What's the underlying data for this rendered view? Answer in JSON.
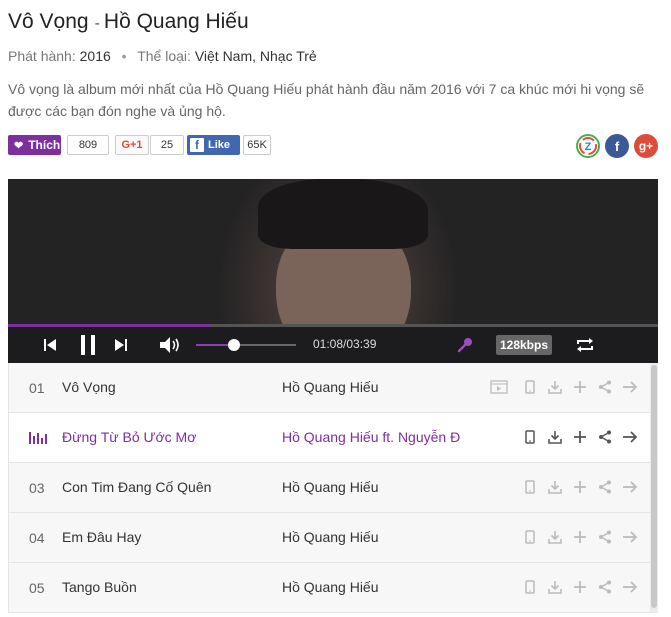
{
  "album": {
    "title": "Vô Vọng",
    "separator": "-",
    "artist": "Hồ Quang Hiếu",
    "release_label": "Phát hành:",
    "release_year": "2016",
    "genre_label": "Thể loại:",
    "genres": "Việt Nam, Nhạc Trẻ",
    "description": "Vô vọng là album mới nhất của Hồ Quang Hiếu phát hành đầu năm 2016 với 7 ca khúc mới hi vọng sẽ được các bạn đón nghe và ủng hộ."
  },
  "social": {
    "like_label": "Thích",
    "like_count": "809",
    "gplus_label": "G+1",
    "gplus_count": "25",
    "fb_label": "Like",
    "fb_count": "65K",
    "share_icons": [
      "zing-share-icon",
      "facebook-share-icon",
      "google-plus-share-icon"
    ]
  },
  "player": {
    "current_time": "01:08",
    "duration": "03:39",
    "time_display": "01:08/03:39",
    "progress_fraction": 0.31,
    "volume_fraction": 0.38,
    "bitrate": "128kbps",
    "accent_color": "#7d2f9e"
  },
  "tracks": [
    {
      "num": "01",
      "title": "Vô Vọng",
      "artist": "Hồ Quang Hiếu",
      "active": false,
      "has_mv": true
    },
    {
      "num": "",
      "title": "Đừng Từ Bỏ Ước Mơ",
      "artist": "Hồ Quang Hiếu  ft. Nguyễn Đ",
      "active": true,
      "has_mv": false
    },
    {
      "num": "03",
      "title": "Con Tim Đang Cố Quên",
      "artist": "Hồ Quang Hiếu",
      "active": false,
      "has_mv": false
    },
    {
      "num": "04",
      "title": "Em Đâu Hay",
      "artist": "Hồ Quang Hiếu",
      "active": false,
      "has_mv": false
    },
    {
      "num": "05",
      "title": "Tango Buồn",
      "artist": "Hồ Quang Hiếu",
      "active": false,
      "has_mv": false
    }
  ]
}
